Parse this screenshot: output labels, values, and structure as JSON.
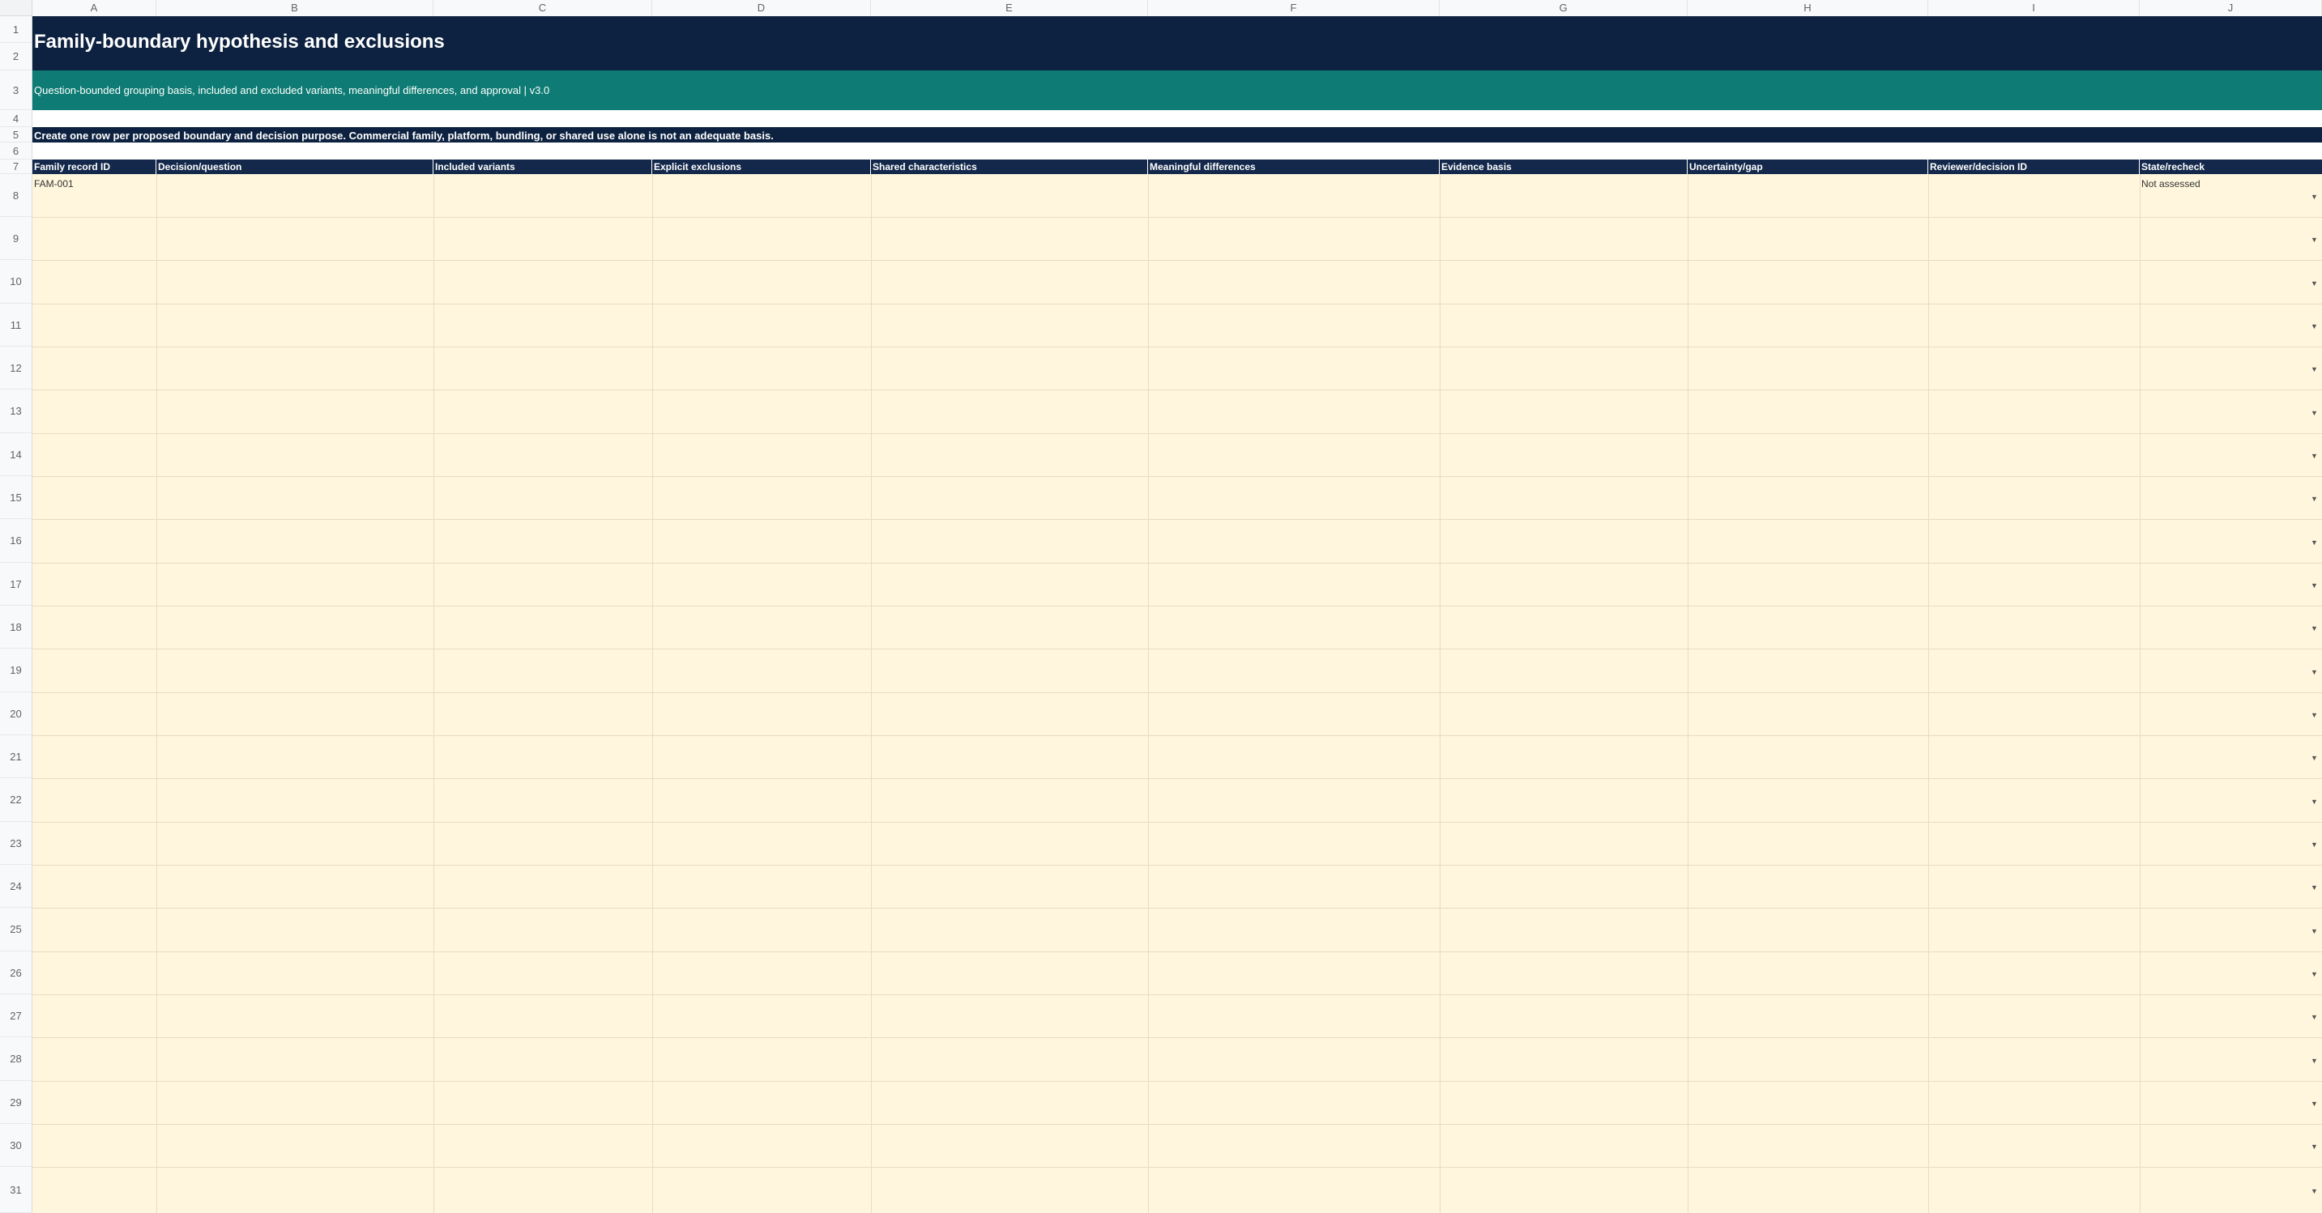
{
  "columns": [
    "A",
    "B",
    "C",
    "D",
    "E",
    "F",
    "G",
    "H",
    "I",
    "J"
  ],
  "title": "Family-boundary hypothesis and exclusions",
  "subtitle": "Question-bounded grouping basis, included and excluded variants, meaningful differences, and approval | v3.0",
  "note": "Create one row per proposed boundary and decision purpose. Commercial family, platform, bundling, or shared use alone is not an adequate basis.",
  "headers": [
    "Family record ID",
    "Decision/question",
    "Included variants",
    "Explicit exclusions",
    "Shared characteristics",
    "Meaningful differences",
    "Evidence basis",
    "Uncertainty/gap",
    "Reviewer/decision ID",
    "State/recheck"
  ],
  "rows": [
    {
      "id": "FAM-001",
      "state": "Not assessed"
    }
  ],
  "row_numbers": [
    "1",
    "2",
    "3",
    "4",
    "5",
    "6",
    "7",
    "8",
    "9",
    "10",
    "11",
    "12",
    "13",
    "14",
    "15",
    "16",
    "17",
    "18",
    "19",
    "20",
    "21",
    "22",
    "23",
    "24",
    "25",
    "26",
    "27",
    "28",
    "29",
    "30",
    "31"
  ],
  "dropdown_arrow": "▼",
  "colors": {
    "title_band": "#0d2240",
    "subtitle_band": "#0e7c74",
    "header_band": "#13284a",
    "data_fill": "#fff6dd"
  }
}
